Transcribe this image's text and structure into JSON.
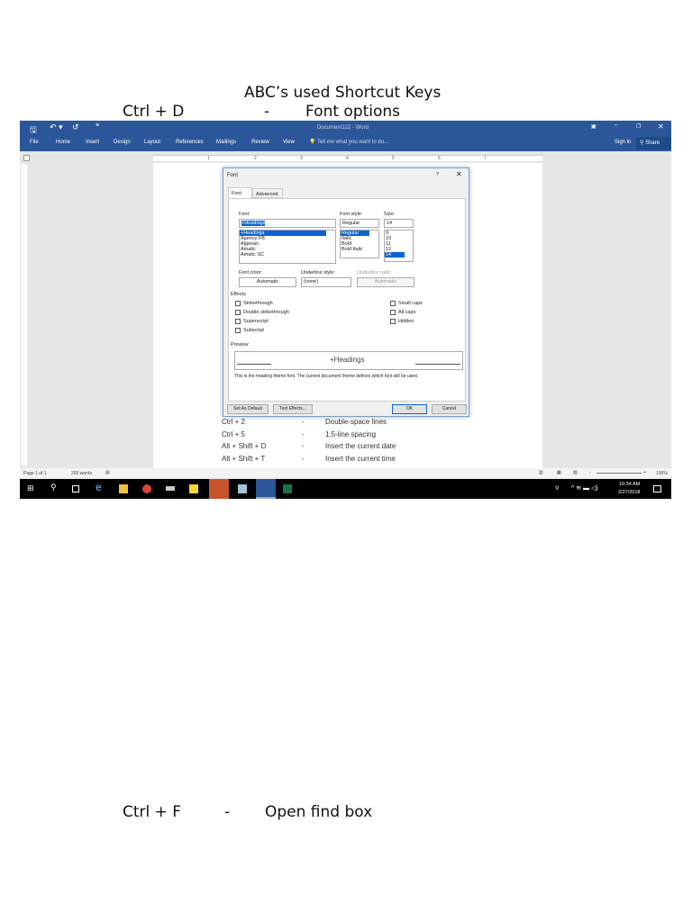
{
  "heading": "ABC’s used Shortcut Keys",
  "shortcuts": [
    {
      "keys": "Ctrl + D",
      "sep": "-",
      "desc": "Font options"
    },
    {
      "keys": "Ctrl + F",
      "sep": "-",
      "desc": "Open find box"
    }
  ],
  "word": {
    "title": "Document122 - Word",
    "tabs": [
      "File",
      "Home",
      "Insert",
      "Design",
      "Layout",
      "References",
      "Mailings",
      "Review",
      "View"
    ],
    "tell_me": "Tell me what you want to do...",
    "sign_in": "Sign in",
    "share": "Share",
    "ruler_nums": [
      "1",
      "2",
      "3",
      "4",
      "5",
      "6",
      "7"
    ],
    "doc_lines": [
      {
        "keys": "Ctrl + 2",
        "sep": "-",
        "desc": "Double-space lines"
      },
      {
        "keys": "Ctrl + 5",
        "sep": "-",
        "desc": "1.5-line spacing"
      },
      {
        "keys": "Alt + Shift + D",
        "sep": "-",
        "desc": "Insert the current date"
      },
      {
        "keys": "Alt + Shift + T",
        "sep": "-",
        "desc": "Insert the current time"
      }
    ],
    "status": {
      "page": "Page 1 of 1",
      "words": "203 words",
      "zoom": "100%"
    },
    "clock": {
      "time": "10:34 AM",
      "date": "2/27/2018"
    },
    "dialog": {
      "title": "Font",
      "help": "?",
      "tabs": [
        "Font",
        "Advanced"
      ],
      "font_label": "Font:",
      "font_value": "+Headings",
      "fonts": [
        "+Headings",
        "Agency FB",
        "Algerian",
        "Amatic",
        "Amatic SC"
      ],
      "style_label": "Font style:",
      "style_value": "Regular",
      "styles": [
        "Regular",
        "Italic",
        "Bold",
        "Bold Italic"
      ],
      "size_label": "Size:",
      "size_value": "14",
      "sizes": [
        "9",
        "10",
        "11",
        "12",
        "14"
      ],
      "color_label": "Font color:",
      "color_value": "Automatic",
      "underline_label": "Underline style:",
      "underline_value": "(none)",
      "ucolor_label": "Underline color:",
      "ucolor_value": "Automatic",
      "effects_label": "Effects",
      "effects_left": [
        "Strikethrough",
        "Double strikethrough",
        "Superscript",
        "Subscript"
      ],
      "effects_right": [
        "Small caps",
        "All caps",
        "Hidden"
      ],
      "preview_label": "Preview",
      "preview_text": "+Headings",
      "preview_note": "This is the heading theme font. The current document theme defines which font will be used.",
      "buttons": {
        "default": "Set As Default",
        "effects": "Text Effects...",
        "ok": "OK",
        "cancel": "Cancel"
      }
    }
  }
}
